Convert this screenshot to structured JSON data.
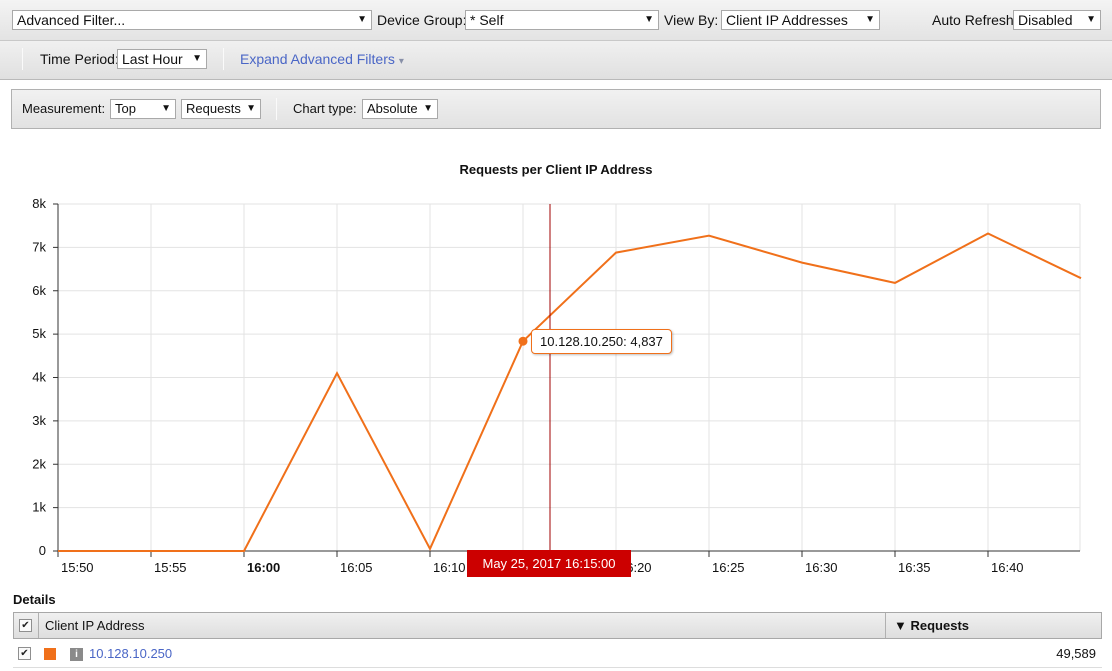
{
  "filters": {
    "advanced_filter": "Advanced Filter...",
    "device_group_label": "Device Group:",
    "device_group_value": "* Self",
    "view_by_label": "View By:",
    "view_by_value": "Client IP Addresses",
    "auto_refresh_label": "Auto Refresh",
    "auto_refresh_value": "Disabled",
    "time_period_label": "Time Period:",
    "time_period_value": "Last Hour",
    "expand_link": "Expand Advanced Filters"
  },
  "measurement": {
    "label": "Measurement:",
    "top_value": "Top",
    "metric_value": "Requests",
    "chart_type_label": "Chart type:",
    "chart_type_value": "Absolute"
  },
  "chart_data": {
    "type": "line",
    "title": "Requests per Client IP Address",
    "xlabel": "",
    "ylabel": "",
    "ylim": [
      0,
      8000
    ],
    "yticks": [
      0,
      1000,
      2000,
      3000,
      4000,
      5000,
      6000,
      7000,
      8000
    ],
    "ytick_labels": [
      "0",
      "1k",
      "2k",
      "3k",
      "4k",
      "5k",
      "6k",
      "7k",
      "8k"
    ],
    "xtick_labels": [
      "15:50",
      "15:55",
      "16:00",
      "16:05",
      "16:10",
      "16:15",
      "16:20",
      "16:25",
      "16:30",
      "16:35",
      "16:40"
    ],
    "xtick_bold": "16:00",
    "grid": true,
    "series": [
      {
        "name": "10.128.10.250",
        "color": "#f0701a",
        "x": [
          "15:50",
          "15:55",
          "16:00",
          "16:05",
          "16:10",
          "16:15",
          "16:20",
          "16:25",
          "16:30",
          "16:35",
          "16:40",
          "16:45"
        ],
        "values": [
          0,
          0,
          0,
          4100,
          50,
          4837,
          6880,
          7270,
          6650,
          6180,
          7320,
          6290
        ]
      }
    ],
    "tooltip": "10.128.10.250: 4,837",
    "crosshair_label": "May 25, 2017 16:15:00",
    "crosshair_color": "#cc0000"
  },
  "details": {
    "title": "Details",
    "col_ip": "Client IP Address",
    "col_requests": "▼ Requests",
    "rows": [
      {
        "ip": "10.128.10.250",
        "requests": "49,589",
        "color": "#f0701a"
      }
    ]
  }
}
